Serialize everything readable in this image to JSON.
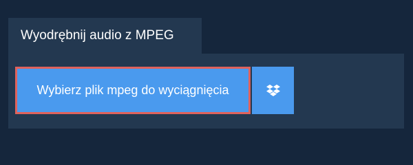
{
  "tab": {
    "label": "Wyodrębnij audio z MPEG"
  },
  "upload": {
    "label": "Wybierz plik mpeg do wyciągnięcia"
  },
  "dropbox": {
    "icon": "dropbox-icon"
  },
  "colors": {
    "background": "#15263c",
    "panel": "#233850",
    "button": "#4a9aee",
    "highlight_border": "#e0625c",
    "text": "#ffffff"
  }
}
